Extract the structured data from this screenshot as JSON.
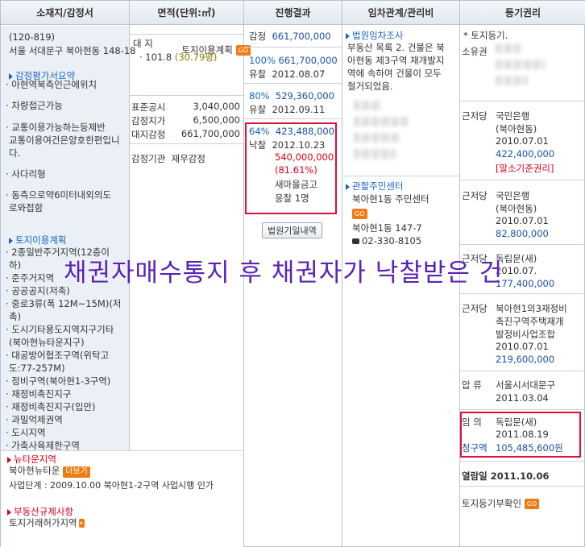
{
  "headers": {
    "location": "소재지/감정서",
    "area": "면적(단위:㎡)",
    "progress": "진행결과",
    "tenant": "임차관계/관리비",
    "registry": "등기권리"
  },
  "location": {
    "zipcode": "(120-819)",
    "address": "서울 서대문구 북아현동 148-18",
    "land_plan_label": "토지이용계획",
    "go": "GO",
    "appraisal_summary_title": "감정평가서요약",
    "appraisal_items": [
      "· 아현역북측인근에위치",
      "· 차량접근가능",
      "· 교통이용가능하는등제반",
      "교통이용여건은양호한편입니",
      "다.",
      "· 사다리형",
      "· 동측으로약6미터내외의도",
      "로와접함"
    ],
    "land_use_title": "토지이용계획",
    "land_use_items": [
      "· 2종일반주거지역(12층이",
      "하)",
      "· 준주거지역",
      "· 공공공지(저촉)",
      "· 중로3류(폭 12M~15M)(저",
      "촉)",
      "· 도시기타용도지역지구기타",
      "(북아현뉴타운지구)",
      "· 대공방어협조구역(위탁고",
      "도:77-257M)",
      "· 정비구역(북아현1-3구역)",
      "· 재정비촉진지구",
      "· 재정비촉진지구(입안)",
      "· 과밀억제권역",
      "· 도시지역",
      "· 가축사육제한구역"
    ],
    "newtown_title": "뉴타운지역",
    "newtown_name": "북아현뉴타운",
    "more": "더보기",
    "project_stage": "사업단계 : 2009.10.00 북아현1-2구역 사업시행 인가",
    "real_estate_title": "부동산규제사항",
    "land_permit": "토지거래허가지역"
  },
  "area": {
    "land_label": "대 지",
    "land_value": "· 101.8",
    "land_pyeong": "(30.79평)",
    "public_notice_label": "표준공시",
    "public_notice_value": "3,040,000",
    "appraised_unit_label": "감정지가",
    "appraised_unit_value": "6,500,000",
    "land_appraisal_label": "대지감정",
    "land_appraisal_value": "661,700,000",
    "appraiser_label": "감정기관",
    "appraiser_value": "재우감정"
  },
  "progress": {
    "appraisal_label": "감정",
    "appraisal_value": "661,700,000",
    "r1_pct": "100%",
    "r1_value": "661,700,000",
    "r1_result": "유찰",
    "r1_date": "2012.08.07",
    "r2_pct": "80%",
    "r2_value": "529,360,000",
    "r2_result": "유찰",
    "r2_date": "2012.09.11",
    "r3_pct": "64%",
    "r3_value": "423,488,000",
    "r3_result": "낙찰",
    "r3_date": "2012.10.23",
    "winning_bid": "540,000,000",
    "winning_rate": "(81.61%)",
    "winner_line1": "새마을금고",
    "winner_line2": "응찰 1명",
    "court_button": "법원기일내역"
  },
  "tenant": {
    "title": "법원임차조사",
    "text": [
      "부동산 목록 2. 건물은 북",
      "아현동 제3구역 재개발지",
      "역에 속하여 건물이 모두",
      "철거되었음."
    ],
    "office_title": "관할주민센터",
    "office_name": "북아현1동 주민센터",
    "go": "GO",
    "office_address": "북아현1동 147-7",
    "office_phone": "02-330-8105"
  },
  "registry": {
    "land_registry": "* 토지등기.",
    "owner_label": "소유권",
    "m1_label": "근저당",
    "m1_bank": "국민은행",
    "m1_branch": "(북아현동)",
    "m1_date": "2010.07.01",
    "m1_amount": "422,400,000",
    "m1_note": "[말소기준권리]",
    "m2_label": "근저당",
    "m2_bank": "국민은행",
    "m2_branch": "(북아현동)",
    "m2_date": "2010.07.01",
    "m2_amount": "82,800,000",
    "m3_label": "근저당",
    "m3_name": "독립문(새)",
    "m3_date": "2010.07.",
    "m3_amount": "177,400,000",
    "m4_label": "근저당",
    "m4_name_lines": [
      "북아현1의3재정비",
      "촉진구역주택재개",
      "발정비사업조합"
    ],
    "m4_date": "2010.07.01",
    "m4_amount": "219,600,000",
    "seizure_label": "압 류",
    "seizure_name": "서울시서대문구",
    "seizure_date": "2011.03.04",
    "auction_label": "임 의",
    "auction_name": "독립문(새)",
    "auction_date": "2011.08.19",
    "claim_label": "청구액",
    "claim_amount": "105,485,600원",
    "view_date": "열람일 2011.10.06",
    "land_registry_check": "토지등기부확인",
    "go": "GO"
  },
  "overlay_caption": "채권자매수통지 후 채권자가 낙찰받은 건",
  "colors": {
    "header_bg": "#e3e8ef",
    "link_blue": "#1a65c8",
    "red": "#d8001c",
    "highlight_box": "#e0103a",
    "overlay_text": "#5a23b7",
    "go_button": "#f07b12"
  }
}
